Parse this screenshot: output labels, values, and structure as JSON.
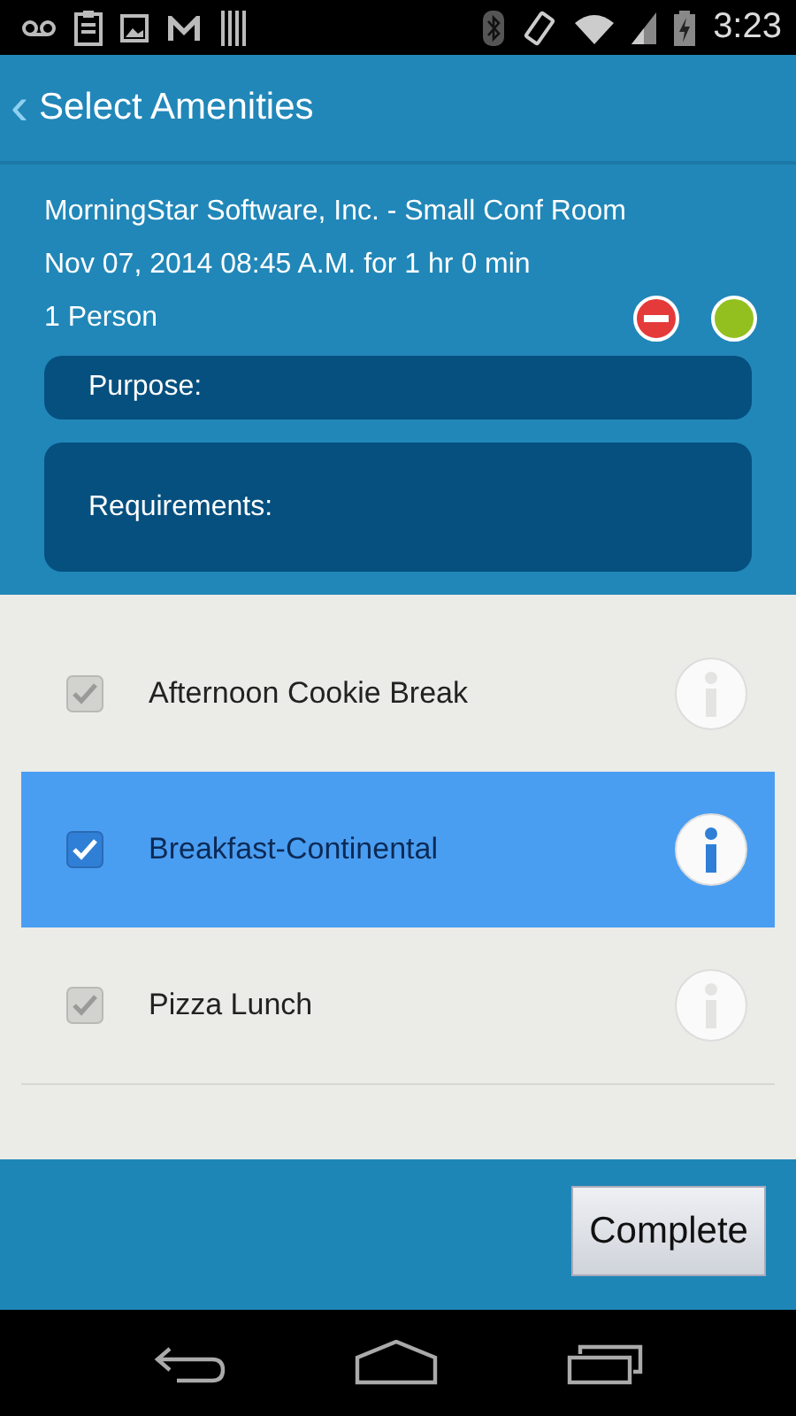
{
  "status_bar": {
    "time": "3:23"
  },
  "header": {
    "back": "‹",
    "title": "Select Amenities"
  },
  "booking": {
    "location": "MorningStar Software, Inc. - Small Conf Room",
    "when": "Nov 07, 2014 08:45 A.M. for 1 hr 0 min",
    "attendees": "1 Person"
  },
  "fields": [
    {
      "label": "Purpose:",
      "kind": "single"
    },
    {
      "label": "Requirements:",
      "kind": "multi"
    }
  ],
  "amenities": [
    {
      "label": "Afternoon Cookie Break",
      "checked": true,
      "selected": false
    },
    {
      "label": "Breakfast-Continental",
      "checked": true,
      "selected": true
    },
    {
      "label": "Pizza Lunch",
      "checked": true,
      "selected": false
    }
  ],
  "footer": {
    "button": "Complete"
  }
}
